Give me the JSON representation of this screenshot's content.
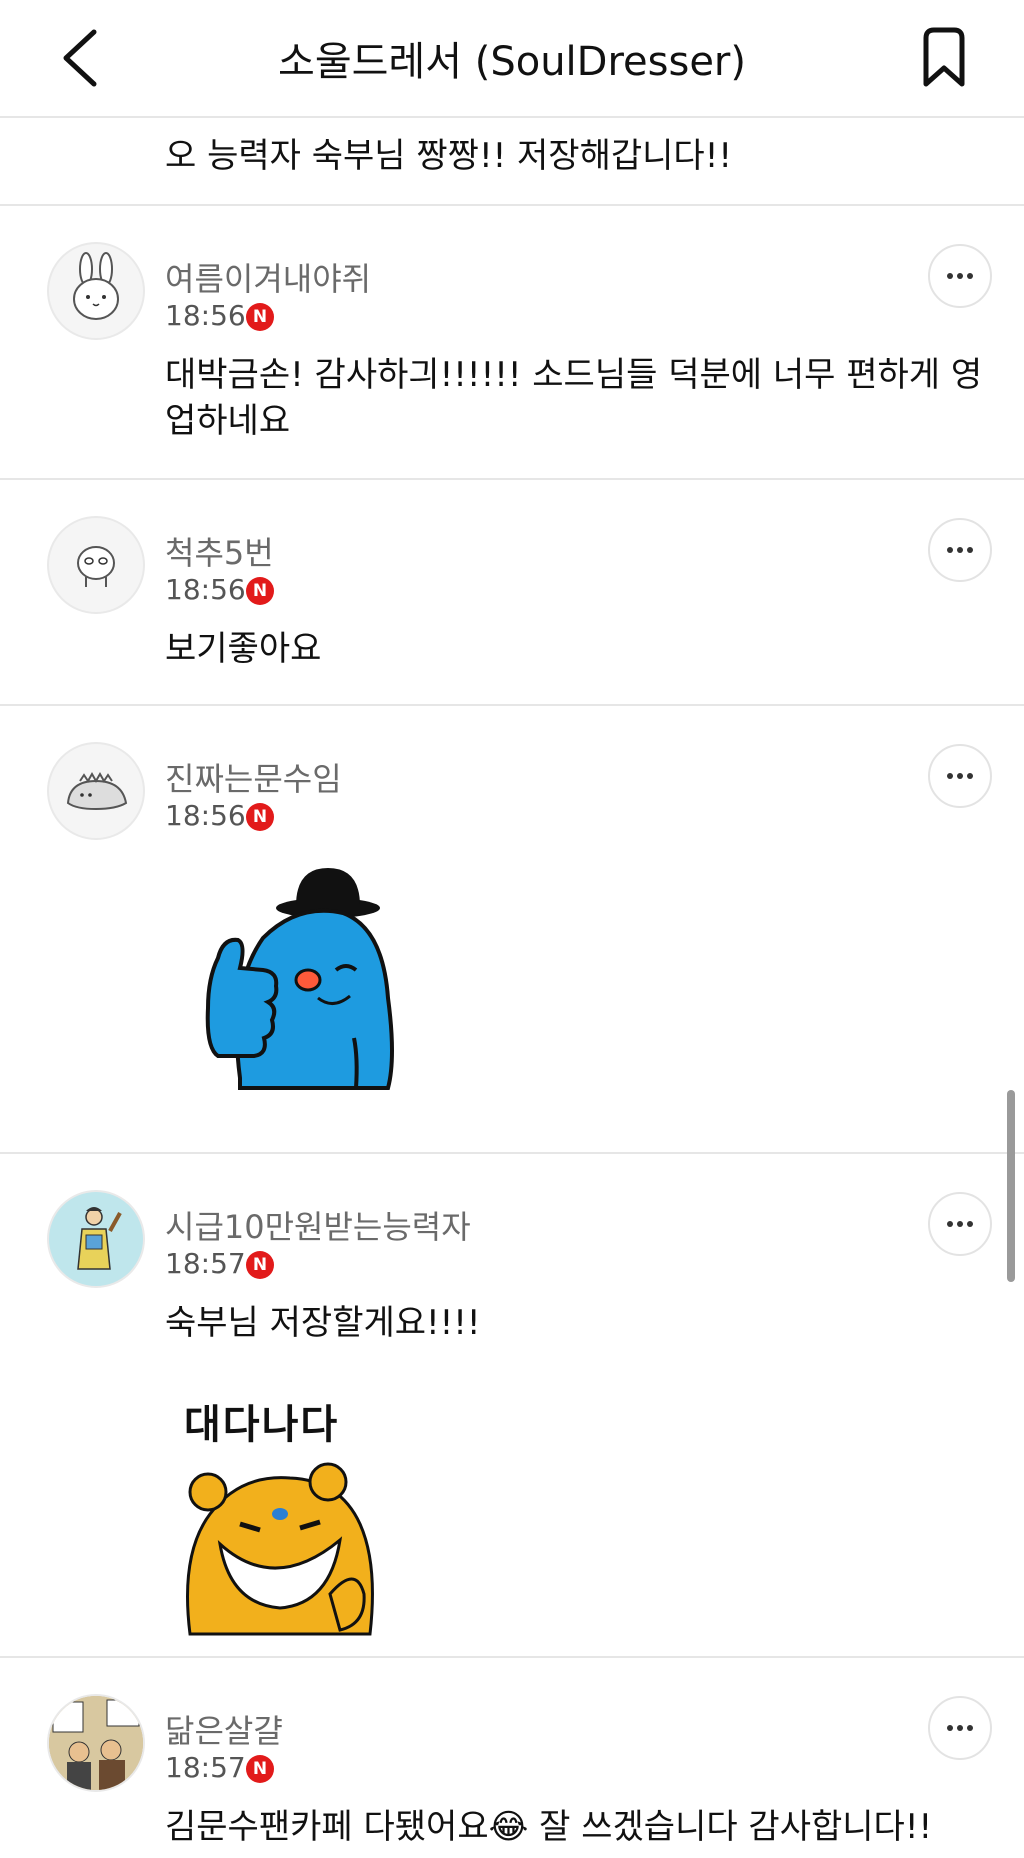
{
  "header": {
    "title": "소울드레서 (SoulDresser)"
  },
  "comments": [
    {
      "text": "오 능력자 숙부님 짱짱!! 저장해갑니다!!"
    },
    {
      "username": "여름이겨내야쥐",
      "time": "18:56",
      "badge": "N",
      "text": "대박금손! 감사하긔!!!!!! 소드님들 덕분에 너무 편하게 영업하네요"
    },
    {
      "username": "척추5번",
      "time": "18:56",
      "badge": "N",
      "text": "보기좋아요"
    },
    {
      "username": "진짜는문수임",
      "time": "18:56",
      "badge": "N",
      "sticker": "thumbs-up-blue-character"
    },
    {
      "username": "시급10만원받는능력자",
      "time": "18:57",
      "badge": "N",
      "text": "숙부님 저장할게요!!!!",
      "sticker_text": "대다나다"
    },
    {
      "username": "닮은살걀",
      "time": "18:57",
      "badge": "N",
      "text": "김문수팬카페 다됐어요😂 잘 쓰겠습니다 감사합니다!!"
    }
  ],
  "colors": {
    "badge": "#e21a1a",
    "divider": "#e6e6e6",
    "username": "#6a6a6a"
  }
}
